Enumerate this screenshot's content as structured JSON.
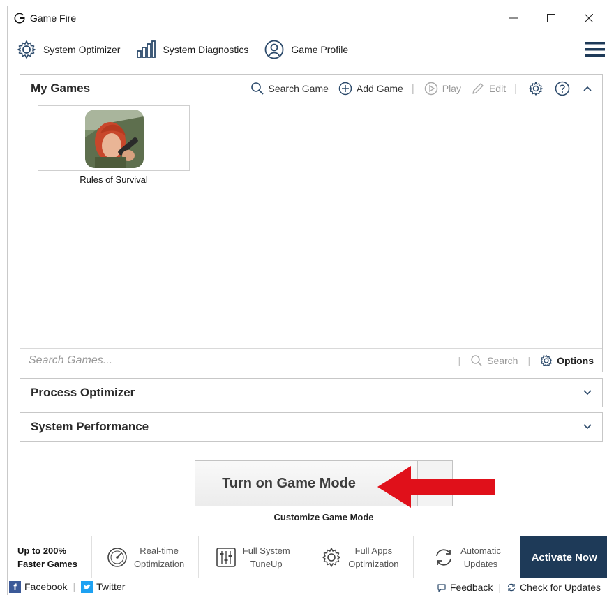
{
  "window": {
    "title": "Game Fire"
  },
  "toolbar": {
    "items": [
      {
        "label": "System Optimizer",
        "icon": "gear-icon"
      },
      {
        "label": "System Diagnostics",
        "icon": "bar-chart-icon"
      },
      {
        "label": "Game Profile",
        "icon": "user-profile-icon"
      }
    ]
  },
  "my_games": {
    "title": "My Games",
    "actions": {
      "search": "Search Game",
      "add": "Add Game",
      "play": "Play",
      "edit": "Edit"
    },
    "games": [
      {
        "name": "Rules of Survival"
      }
    ],
    "search_placeholder": "Search Games...",
    "search_button": "Search",
    "options_button": "Options"
  },
  "panels": {
    "process": "Process Optimizer",
    "performance": "System Performance"
  },
  "game_mode": {
    "button": "Turn on Game Mode",
    "customize": "Customize Game Mode"
  },
  "features": {
    "lead": [
      "Up to 200%",
      "Faster Games"
    ],
    "items": [
      {
        "lines": [
          "Real-time",
          "Optimization"
        ],
        "icon": "speedometer-icon"
      },
      {
        "lines": [
          "Full System",
          "TuneUp"
        ],
        "icon": "equalizer-icon"
      },
      {
        "lines": [
          "Full Apps",
          "Optimization"
        ],
        "icon": "gear-icon"
      },
      {
        "lines": [
          "Automatic",
          "Updates"
        ],
        "icon": "refresh-icon"
      }
    ],
    "activate": "Activate Now"
  },
  "statusbar": {
    "facebook": "Facebook",
    "twitter": "Twitter",
    "feedback": "Feedback",
    "updates": "Check for Updates"
  },
  "colors": {
    "activate_bg": "#1e3a58",
    "arrow": "#e0101a"
  }
}
